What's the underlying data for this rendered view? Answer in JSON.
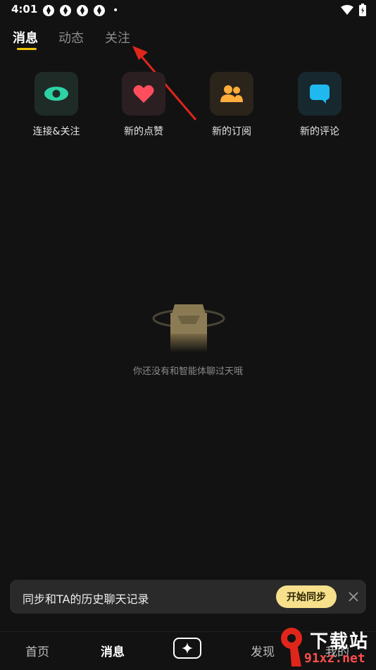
{
  "status_bar": {
    "time": "4:01",
    "notification_icons": [
      "app-icon",
      "app-icon",
      "app-icon",
      "app-icon"
    ],
    "dot": "•"
  },
  "tabs": [
    {
      "label": "消息",
      "active": true
    },
    {
      "label": "动态",
      "active": false
    },
    {
      "label": "关注",
      "active": false
    }
  ],
  "quick_actions": [
    {
      "label": "连接&关注",
      "icon": "eye-icon",
      "bg": "#1f2b27",
      "color": "#2ed3a4"
    },
    {
      "label": "新的点赞",
      "icon": "heart-icon",
      "bg": "#2b1f21",
      "color": "#ff4d5e"
    },
    {
      "label": "新的订阅",
      "icon": "people-icon",
      "bg": "#2b241b",
      "color": "#ffad3b"
    },
    {
      "label": "新的评论",
      "icon": "comment-icon",
      "bg": "#17282f",
      "color": "#1fb9f0"
    }
  ],
  "empty_state": {
    "text": "你还没有和智能体聊过天哦"
  },
  "sync_banner": {
    "text": "同步和TA的历史聊天记录",
    "button": "开始同步"
  },
  "bottom_nav": [
    {
      "label": "首页",
      "active": false
    },
    {
      "label": "消息",
      "active": true
    },
    {
      "label": "发现",
      "active": false
    },
    {
      "label": "我的",
      "active": false
    }
  ],
  "watermark": {
    "top": "下载站",
    "bottom": "91xz.net"
  },
  "colors": {
    "accent": "#f0c400",
    "background": "#121212",
    "annotation_arrow": "#e0261b"
  }
}
